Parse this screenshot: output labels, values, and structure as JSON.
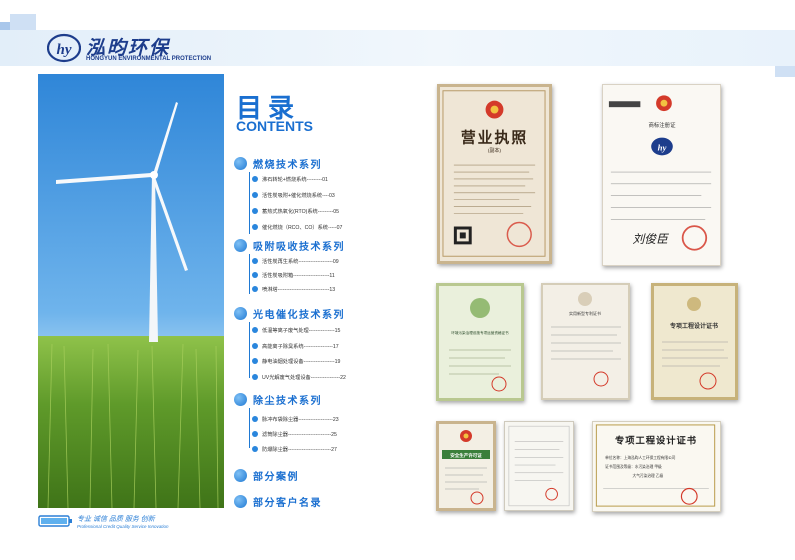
{
  "brand": {
    "name_cn": "泓昀环保",
    "name_en": "HONGYUN ENVIRONMENTAL PROTECTION",
    "logo_text": "hy"
  },
  "slogan": {
    "cn": "专业 诚信 品质 服务 创新",
    "en": "Professional Credit Quality Service Innovation"
  },
  "toc": {
    "title": "目录",
    "subtitle": "CONTENTS",
    "sections": [
      {
        "label": "燃烧技术系列",
        "items": [
          {
            "text": "沸石转轮+燃烧系统---------01"
          },
          {
            "text": "活性炭吸附+催化燃烧系统----03"
          },
          {
            "text": "蓄热式热氧化(RTO)系统---------05"
          },
          {
            "text": "催化燃烧（RCO、CO）系统-----07"
          }
        ]
      },
      {
        "label": "吸附吸收技术系列",
        "items": [
          {
            "text": "活性炭再生系统--------------------09"
          },
          {
            "text": "活性炭吸附箱---------------------11"
          },
          {
            "text": "喷淋塔------------------------------13"
          }
        ]
      },
      {
        "label": "光电催化技术系列",
        "items": [
          {
            "text": "低温等离子废气处理---------------15"
          },
          {
            "text": "高能离子除臭系统-----------------17"
          },
          {
            "text": "静电油烟处理设备------------------19"
          },
          {
            "text": "UV光解废气处理设备-----------------22"
          }
        ]
      },
      {
        "label": "除尘技术系列",
        "items": [
          {
            "text": "脉冲布袋除尘器--------------------23"
          },
          {
            "text": "滤筒除尘器-------------------------25"
          },
          {
            "text": "防爆除尘器-------------------------27"
          }
        ]
      },
      {
        "label": "部分案例",
        "items": []
      },
      {
        "label": "部分客户名录",
        "items": []
      }
    ]
  },
  "certificates": {
    "business_license": {
      "title": "营业执照",
      "subtitle": "(副本)"
    },
    "trademark": {
      "title": "商标注册证",
      "signature": "刘俊臣"
    },
    "eia_cert": {
      "title": "环境污染治理设施专项运营资格证书"
    },
    "patent": {
      "title": "实用新型专利证书"
    },
    "design_cert_small": {
      "title": "专项工程设计证书"
    },
    "safety_license": {
      "title": "安全生产许可证"
    },
    "design_cert_large": {
      "title": "专项工程设计证书",
      "lines": [
        "单位名称：上海泓昀人工环保工程有限公司",
        "证书范围及等级：水污染治理    甲级",
        "大气污染治理    乙级"
      ]
    }
  },
  "colors": {
    "accent": "#1a6fd0",
    "brand": "#1d3d8c",
    "band": "#e2eef9"
  }
}
